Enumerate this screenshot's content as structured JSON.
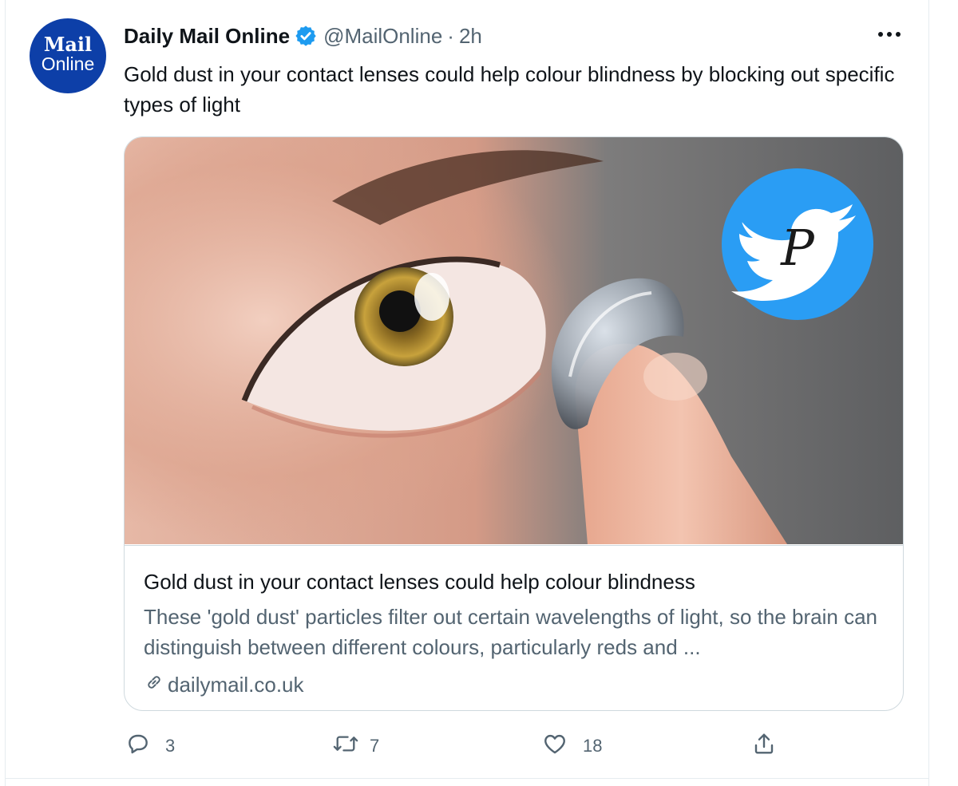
{
  "account": {
    "avatar_line1": "Mail",
    "avatar_line2": "Online",
    "display_name": "Daily Mail Online",
    "handle": "@MailOnline",
    "separator": "·",
    "time": "2h"
  },
  "tweet": {
    "text": "Gold dust in your contact lenses could help colour blindness by blocking out specific types of light"
  },
  "card": {
    "title": "Gold dust in your contact lenses could help colour blindness",
    "description": "These 'gold dust' particles filter out certain wavelengths of light, so the brain can distinguish between different colours, particularly reds and ...",
    "domain": "dailymail.co.uk",
    "link_icon": "link-icon",
    "watermark_icon": "twitter-bird-icon"
  },
  "actions": {
    "reply_count": "3",
    "retweet_count": "7",
    "like_count": "18"
  },
  "colors": {
    "avatar_bg": "#0d3fa8",
    "verified": "#1d9bf0",
    "secondary_text": "#536471",
    "primary_text": "#0f1419",
    "border": "#cfd9de"
  }
}
